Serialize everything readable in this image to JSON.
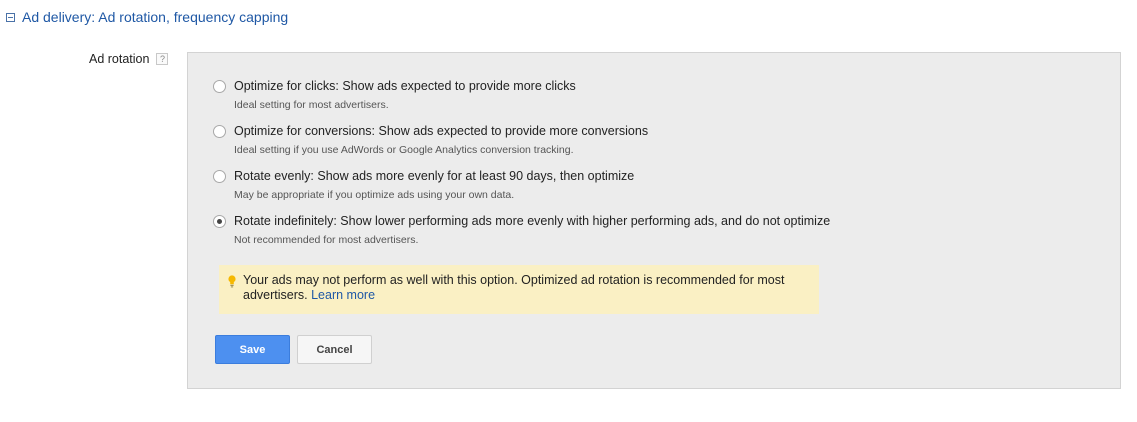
{
  "section": {
    "title": "Ad delivery: Ad rotation, frequency capping"
  },
  "field": {
    "label": "Ad rotation",
    "help": "?"
  },
  "options": [
    {
      "label": "Optimize for clicks: Show ads expected to provide more clicks",
      "description": "Ideal setting for most advertisers.",
      "selected": false
    },
    {
      "label": "Optimize for conversions: Show ads expected to provide more conversions",
      "description": "Ideal setting if you use AdWords or Google Analytics conversion tracking.",
      "selected": false
    },
    {
      "label": "Rotate evenly: Show ads more evenly for at least 90 days, then optimize",
      "description": "May be appropriate if you optimize ads using your own data.",
      "selected": false
    },
    {
      "label": "Rotate indefinitely: Show lower performing ads more evenly with higher performing ads, and do not optimize",
      "description": "Not recommended for most advertisers.",
      "selected": true
    }
  ],
  "warning": {
    "text": "Your ads may not perform as well with this option. Optimized ad rotation is recommended for most advertisers.",
    "link": "Learn more",
    "icon": "lightbulb-icon"
  },
  "buttons": {
    "save": "Save",
    "cancel": "Cancel"
  },
  "colors": {
    "link": "#1f58a5",
    "panel_bg": "#ececec",
    "warning_bg": "#faf0c4",
    "save_bg": "#4d90f0"
  }
}
